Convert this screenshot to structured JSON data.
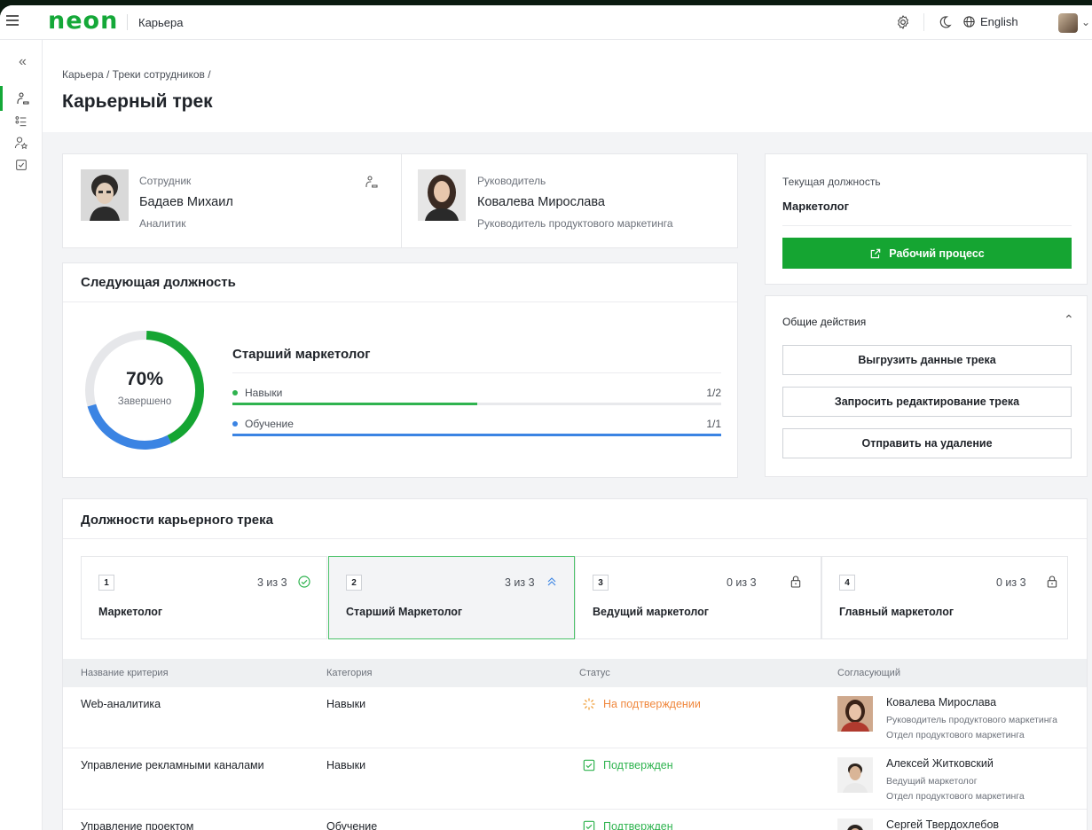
{
  "app": {
    "logo": "neon",
    "section": "Карьера",
    "language": "English"
  },
  "breadcrumb": [
    "Карьера",
    "/",
    "Треки сотрудников",
    "/"
  ],
  "page_title": "Карьерный трек",
  "employee": {
    "role_label": "Сотрудник",
    "name": "Бадаев Михаил",
    "position": "Аналитик"
  },
  "manager": {
    "role_label": "Руководитель",
    "name": "Ковалева Мирослава",
    "position": "Руководитель продуктового маркетинга"
  },
  "current": {
    "label": "Текущая должность",
    "value": "Маркетолог",
    "workflow_button": "Рабочий процесс"
  },
  "actions": {
    "title": "Общие действия",
    "buttons": [
      "Выгрузить данные трека",
      "Запросить редактирование трека",
      "Отправить на удаление"
    ]
  },
  "next": {
    "title": "Следующая должность",
    "percent_text": "70%",
    "percent_value": 0.7,
    "completed_label": "Завершено",
    "position": "Старший маркетолог",
    "rows": [
      {
        "label": "Навыки",
        "value": "1/2",
        "progress": 0.5,
        "color": "#2fb34f"
      },
      {
        "label": "Обучение",
        "value": "1/1",
        "progress": 1.0,
        "color": "#3b84e3"
      }
    ]
  },
  "track": {
    "title": "Должности карьерного трека",
    "steps": [
      {
        "num": "1",
        "count": "3 из 3",
        "name": "Маркетолог",
        "icon": "check-circle-icon"
      },
      {
        "num": "2",
        "count": "3 из 3",
        "name": "Старший Маркетолог",
        "icon": "double-chevron-up-icon"
      },
      {
        "num": "3",
        "count": "0 из 3",
        "name": "Ведущий маркетолог",
        "icon": "lock-icon"
      },
      {
        "num": "4",
        "count": "0 из 3",
        "name": "Главный маркетолог",
        "icon": "lock-icon"
      }
    ],
    "columns": [
      "Название критерия",
      "Категория",
      "Статус",
      "Согласующий"
    ],
    "rows": [
      {
        "criterion": "Web-аналитика",
        "category": "Навыки",
        "status": "На подтверждении",
        "status_type": "pending",
        "approver": "Ковалева Мирослава",
        "approver_pos": "Руководитель продуктового маркетинга",
        "approver_dept": "Отдел продуктового маркетинга"
      },
      {
        "criterion": "Управление рекламными каналами",
        "category": "Навыки",
        "status": "Подтвержден",
        "status_type": "approved",
        "approver": "Алексей Житковский",
        "approver_pos": "Ведущий маркетолог",
        "approver_dept": "Отдел продуктового маркетинга"
      },
      {
        "criterion": "Управление проектом",
        "category": "Обучение",
        "status": "Подтвержден",
        "status_type": "approved",
        "approver": "Сергей Твердохлебов",
        "approver_pos": "",
        "approver_dept": ""
      }
    ]
  },
  "colors": {
    "brand": "#14a838",
    "pending": "#f0883e",
    "approved": "#2fb34f",
    "blue": "#3b84e3"
  }
}
